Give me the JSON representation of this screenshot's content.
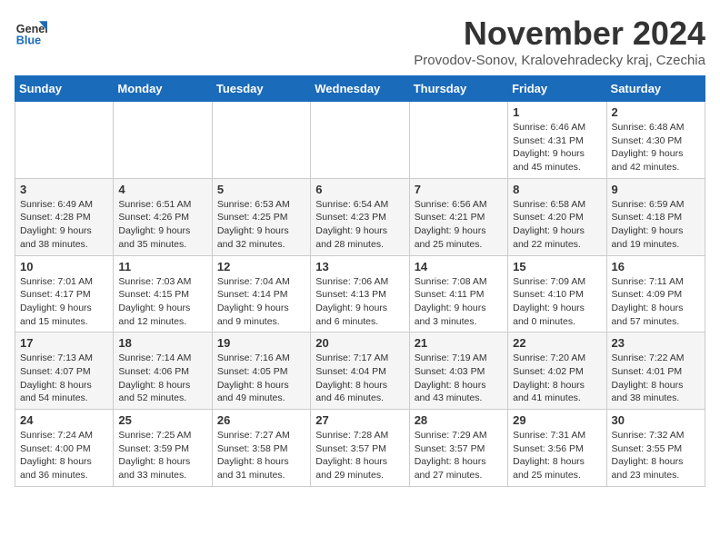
{
  "logo": {
    "line1": "General",
    "line2": "Blue"
  },
  "title": "November 2024",
  "location": "Provodov-Sonov, Kralovehradecky kraj, Czechia",
  "days_of_week": [
    "Sunday",
    "Monday",
    "Tuesday",
    "Wednesday",
    "Thursday",
    "Friday",
    "Saturday"
  ],
  "weeks": [
    [
      {
        "day": "",
        "info": ""
      },
      {
        "day": "",
        "info": ""
      },
      {
        "day": "",
        "info": ""
      },
      {
        "day": "",
        "info": ""
      },
      {
        "day": "",
        "info": ""
      },
      {
        "day": "1",
        "info": "Sunrise: 6:46 AM\nSunset: 4:31 PM\nDaylight: 9 hours and 45 minutes."
      },
      {
        "day": "2",
        "info": "Sunrise: 6:48 AM\nSunset: 4:30 PM\nDaylight: 9 hours and 42 minutes."
      }
    ],
    [
      {
        "day": "3",
        "info": "Sunrise: 6:49 AM\nSunset: 4:28 PM\nDaylight: 9 hours and 38 minutes."
      },
      {
        "day": "4",
        "info": "Sunrise: 6:51 AM\nSunset: 4:26 PM\nDaylight: 9 hours and 35 minutes."
      },
      {
        "day": "5",
        "info": "Sunrise: 6:53 AM\nSunset: 4:25 PM\nDaylight: 9 hours and 32 minutes."
      },
      {
        "day": "6",
        "info": "Sunrise: 6:54 AM\nSunset: 4:23 PM\nDaylight: 9 hours and 28 minutes."
      },
      {
        "day": "7",
        "info": "Sunrise: 6:56 AM\nSunset: 4:21 PM\nDaylight: 9 hours and 25 minutes."
      },
      {
        "day": "8",
        "info": "Sunrise: 6:58 AM\nSunset: 4:20 PM\nDaylight: 9 hours and 22 minutes."
      },
      {
        "day": "9",
        "info": "Sunrise: 6:59 AM\nSunset: 4:18 PM\nDaylight: 9 hours and 19 minutes."
      }
    ],
    [
      {
        "day": "10",
        "info": "Sunrise: 7:01 AM\nSunset: 4:17 PM\nDaylight: 9 hours and 15 minutes."
      },
      {
        "day": "11",
        "info": "Sunrise: 7:03 AM\nSunset: 4:15 PM\nDaylight: 9 hours and 12 minutes."
      },
      {
        "day": "12",
        "info": "Sunrise: 7:04 AM\nSunset: 4:14 PM\nDaylight: 9 hours and 9 minutes."
      },
      {
        "day": "13",
        "info": "Sunrise: 7:06 AM\nSunset: 4:13 PM\nDaylight: 9 hours and 6 minutes."
      },
      {
        "day": "14",
        "info": "Sunrise: 7:08 AM\nSunset: 4:11 PM\nDaylight: 9 hours and 3 minutes."
      },
      {
        "day": "15",
        "info": "Sunrise: 7:09 AM\nSunset: 4:10 PM\nDaylight: 9 hours and 0 minutes."
      },
      {
        "day": "16",
        "info": "Sunrise: 7:11 AM\nSunset: 4:09 PM\nDaylight: 8 hours and 57 minutes."
      }
    ],
    [
      {
        "day": "17",
        "info": "Sunrise: 7:13 AM\nSunset: 4:07 PM\nDaylight: 8 hours and 54 minutes."
      },
      {
        "day": "18",
        "info": "Sunrise: 7:14 AM\nSunset: 4:06 PM\nDaylight: 8 hours and 52 minutes."
      },
      {
        "day": "19",
        "info": "Sunrise: 7:16 AM\nSunset: 4:05 PM\nDaylight: 8 hours and 49 minutes."
      },
      {
        "day": "20",
        "info": "Sunrise: 7:17 AM\nSunset: 4:04 PM\nDaylight: 8 hours and 46 minutes."
      },
      {
        "day": "21",
        "info": "Sunrise: 7:19 AM\nSunset: 4:03 PM\nDaylight: 8 hours and 43 minutes."
      },
      {
        "day": "22",
        "info": "Sunrise: 7:20 AM\nSunset: 4:02 PM\nDaylight: 8 hours and 41 minutes."
      },
      {
        "day": "23",
        "info": "Sunrise: 7:22 AM\nSunset: 4:01 PM\nDaylight: 8 hours and 38 minutes."
      }
    ],
    [
      {
        "day": "24",
        "info": "Sunrise: 7:24 AM\nSunset: 4:00 PM\nDaylight: 8 hours and 36 minutes."
      },
      {
        "day": "25",
        "info": "Sunrise: 7:25 AM\nSunset: 3:59 PM\nDaylight: 8 hours and 33 minutes."
      },
      {
        "day": "26",
        "info": "Sunrise: 7:27 AM\nSunset: 3:58 PM\nDaylight: 8 hours and 31 minutes."
      },
      {
        "day": "27",
        "info": "Sunrise: 7:28 AM\nSunset: 3:57 PM\nDaylight: 8 hours and 29 minutes."
      },
      {
        "day": "28",
        "info": "Sunrise: 7:29 AM\nSunset: 3:57 PM\nDaylight: 8 hours and 27 minutes."
      },
      {
        "day": "29",
        "info": "Sunrise: 7:31 AM\nSunset: 3:56 PM\nDaylight: 8 hours and 25 minutes."
      },
      {
        "day": "30",
        "info": "Sunrise: 7:32 AM\nSunset: 3:55 PM\nDaylight: 8 hours and 23 minutes."
      }
    ]
  ]
}
